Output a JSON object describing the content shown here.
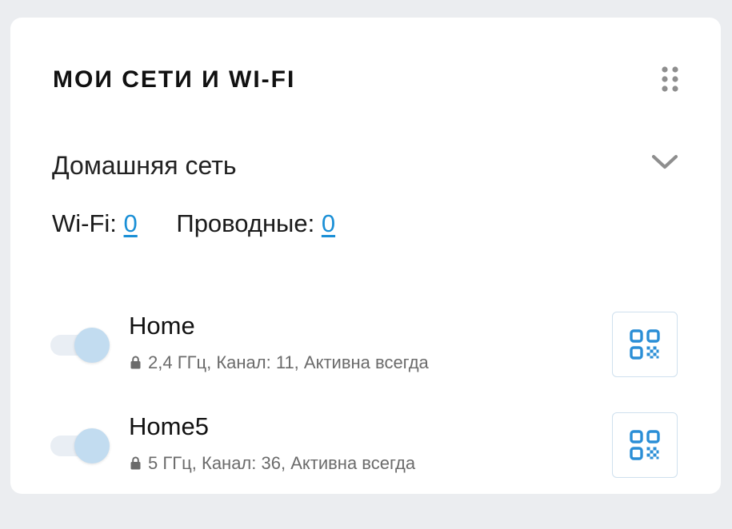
{
  "widget": {
    "title": "МОИ СЕТИ И WI-FI",
    "drag_icon": "drag-handle-icon"
  },
  "section": {
    "title": "Домашняя сеть",
    "expand_icon": "chevron-down-icon"
  },
  "counts": {
    "wifi_label": "Wi-Fi:",
    "wifi_value": "0",
    "wired_label": "Проводные:",
    "wired_value": "0"
  },
  "networks": [
    {
      "name": "Home",
      "info": "2,4 ГГц,  Канал: 11, Активна всегда",
      "enabled": true,
      "lock_icon": "lock-icon",
      "qr_icon": "qr-code-icon"
    },
    {
      "name": "Home5",
      "info": "5 ГГц,  Канал: 36, Активна всегда",
      "enabled": true,
      "lock_icon": "lock-icon",
      "qr_icon": "qr-code-icon"
    }
  ],
  "colors": {
    "page_background": "#ebedf0",
    "card_background": "#ffffff",
    "link": "#1a8fd6",
    "toggle_knob": "#c2dcf0",
    "toggle_track": "#e9eef4",
    "qr_icon": "#2a8ed6",
    "secondary_text": "#6b6b6b",
    "icon_gray": "#8e8e8e"
  }
}
